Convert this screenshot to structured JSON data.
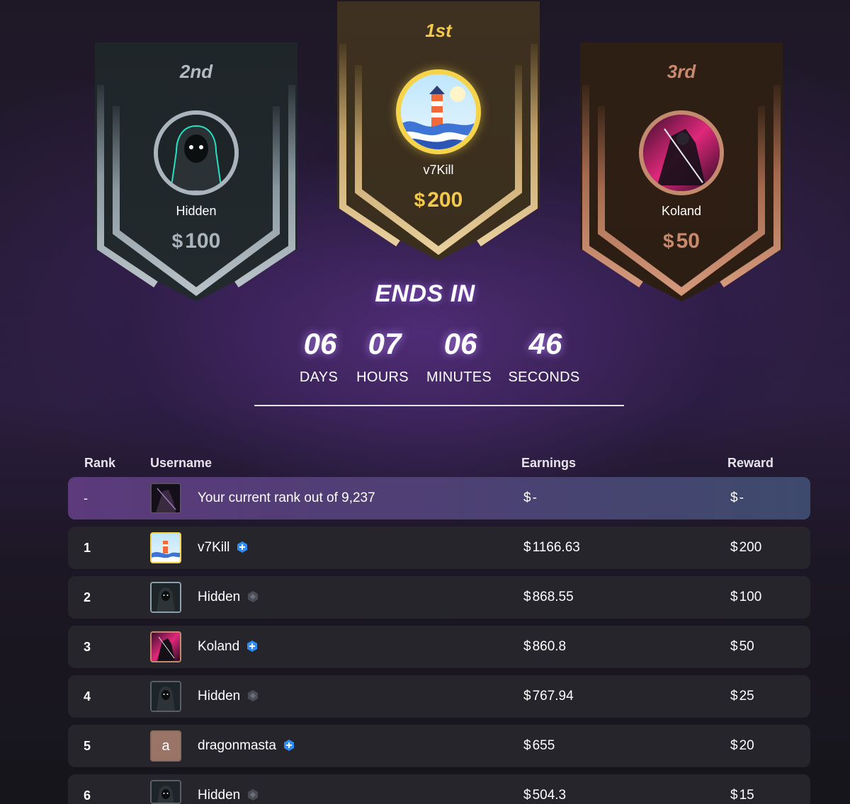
{
  "podium": {
    "second": {
      "place": "2nd",
      "name": "Hidden",
      "currency": "$",
      "amount": "100"
    },
    "first": {
      "place": "1st",
      "name": "v7Kill",
      "currency": "$",
      "amount": "200"
    },
    "third": {
      "place": "3rd",
      "name": "Koland",
      "currency": "$",
      "amount": "50"
    }
  },
  "countdown": {
    "title": "ENDS IN",
    "units": [
      {
        "value": "06",
        "label": "DAYS"
      },
      {
        "value": "07",
        "label": "HOURS"
      },
      {
        "value": "06",
        "label": "MINUTES"
      },
      {
        "value": "46",
        "label": "SECONDS"
      }
    ]
  },
  "table": {
    "headers": {
      "rank": "Rank",
      "username": "Username",
      "earnings": "Earnings",
      "reward": "Reward"
    },
    "current": {
      "rank": "-",
      "text": "Your current rank out of 9,237",
      "earn_cur": "$",
      "earnings": "-",
      "rew_cur": "$",
      "reward": "-"
    },
    "rows": [
      {
        "rank": "1",
        "username": "v7Kill",
        "earn_cur": "$",
        "earnings": "1166.63",
        "rew_cur": "$",
        "reward": "200",
        "avatar": "lighthouse-avatar",
        "badge": "blue-plus-badge-icon"
      },
      {
        "rank": "2",
        "username": "Hidden",
        "earn_cur": "$",
        "earnings": "868.55",
        "rew_cur": "$",
        "reward": "100",
        "avatar": "hooded-figure-avatar",
        "badge": "grey-badge-icon"
      },
      {
        "rank": "3",
        "username": "Koland",
        "earn_cur": "$",
        "earnings": "860.8",
        "rew_cur": "$",
        "reward": "50",
        "avatar": "reaper-avatar",
        "badge": "blue-plus-badge-icon"
      },
      {
        "rank": "4",
        "username": "Hidden",
        "earn_cur": "$",
        "earnings": "767.94",
        "rew_cur": "$",
        "reward": "25",
        "avatar": "hooded-figure-avatar",
        "badge": "grey-badge-icon"
      },
      {
        "rank": "5",
        "username": "dragonmasta",
        "earn_cur": "$",
        "earnings": "655",
        "rew_cur": "$",
        "reward": "20",
        "avatar": "letter-avatar",
        "avatar_letter": "a",
        "badge": "blue-plus-badge-icon"
      },
      {
        "rank": "6",
        "username": "Hidden",
        "earn_cur": "$",
        "earnings": "504.3",
        "rew_cur": "$",
        "reward": "15",
        "avatar": "hooded-figure-avatar",
        "badge": "grey-badge-icon"
      }
    ]
  },
  "colors": {
    "gold": "#f2c94c",
    "silver": "#a9b4bc",
    "bronze": "#c9896c",
    "row_bg": "#26252c",
    "accent_blue": "#2f8cf0"
  }
}
